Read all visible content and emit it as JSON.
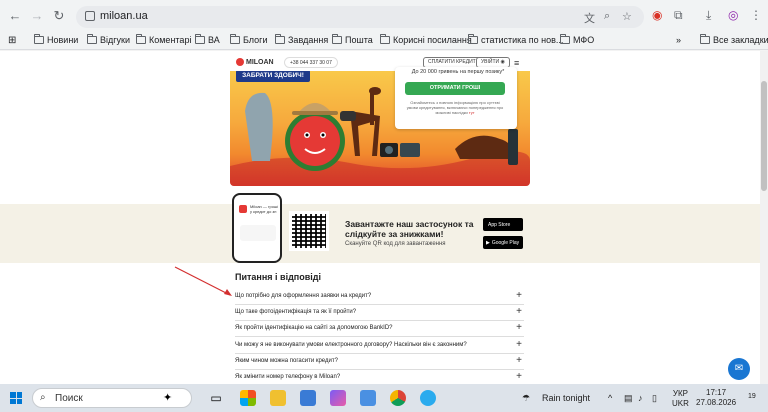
{
  "browser": {
    "url": "miloan.ua",
    "bookmarks": [
      "Новини",
      "Відгуки",
      "Коментарі",
      "ВА",
      "Блоги",
      "Завдання",
      "Пошта",
      "Корисні посилання",
      "статистика по нов...",
      "МФО"
    ],
    "all_bookmarks": "Все закладки"
  },
  "site": {
    "logo": "MILOAN",
    "phone": "+38 044 337 30 07",
    "pay_btn": "СПЛАТИТИ КРЕДИТ",
    "login_btn": "УВІЙТИ",
    "banner_btn": "ЗАБРАТИ ЗДОБИЧ!",
    "promo_text": "До 20 000 гривень на першу позику*",
    "promo_btn": "ОТРИМАТИ ГРОШІ",
    "promo_small": "Ознайомтесь з повною інформацією про суттєві умови кредитування, включаючи попередження про можливі наслідки ",
    "promo_link": "тут",
    "app_title": "Завантажте наш застосунок та слідкуйте за знижками!",
    "app_sub": "Скануйте QR код для завантаження",
    "app_store": "App Store",
    "google_play": "Google Play",
    "phone_screen_text": "Miloan — гроші у кредит до зп",
    "faq_title": "Питання і відповіді",
    "faq": [
      "Що потрібно для оформлення заявки на кредит?",
      "Що таке фотоідентифікація та як її пройти?",
      "Як пройти ідентифікацію на сайті за допомогою BankID?",
      "Чи можу я не виконувати умови електронного договору? Наскільки він є законним?",
      "Яким чином можна погасити кредит?",
      "Як змінити номер телефону в Miloan?"
    ]
  },
  "taskbar": {
    "search": "Поиск",
    "weather": "Rain tonight",
    "lang1": "УКР",
    "lang2": "UKR",
    "time": "17:17",
    "date": "27.08.2026",
    "notif": "19"
  },
  "colors": {
    "accent_green": "#35a853",
    "banner_btn": "#1e3a8a",
    "arrow": "#d32f2f"
  }
}
